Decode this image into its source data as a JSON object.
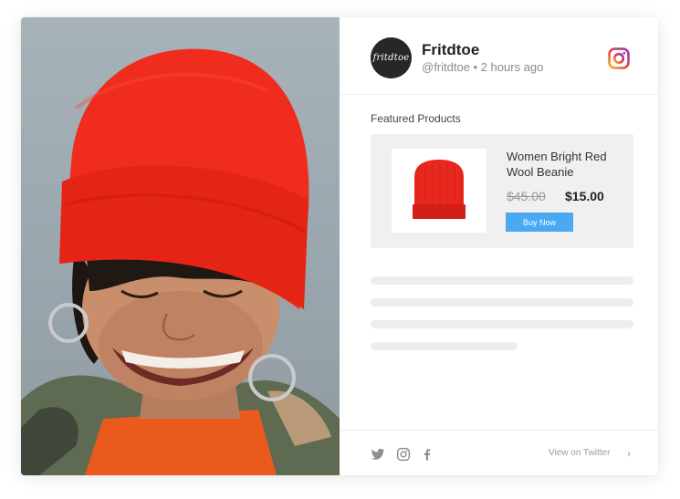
{
  "profile": {
    "avatar_text": "fritdtoe",
    "name": "Fritdtoe",
    "handle_time": "@fritdtoe • 2 hours ago"
  },
  "featured": {
    "label": "Featured Products",
    "product": {
      "title": "Women Bright Red Wool Beanie",
      "old_price": "$45.00",
      "new_price": "$15.00",
      "buy_label": "Buy Now",
      "color": "#e8271e"
    }
  },
  "footer": {
    "icons": [
      "twitter-icon",
      "instagram-icon",
      "facebook-icon"
    ],
    "view_link": "View on Twitter",
    "chevron": "›"
  },
  "colors": {
    "accent": "#4aa9f3",
    "beanie": "#e8271e"
  }
}
